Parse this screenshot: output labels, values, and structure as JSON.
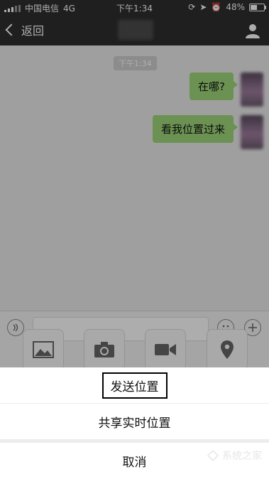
{
  "status_bar": {
    "carrier": "中国电信",
    "network": "4G",
    "time": "下午1:34",
    "battery": "48%",
    "battery_level": 0.48
  },
  "nav": {
    "back_label": "返回"
  },
  "chat": {
    "timestamp": "下午1:34",
    "messages": [
      {
        "text": "在哪?",
        "bubble_color": "#9ed77a"
      },
      {
        "text": "看我位置过来",
        "bubble_color": "#9ed77a"
      }
    ]
  },
  "action_sheet": {
    "send_location": "发送位置",
    "share_live_location": "共享实时位置",
    "cancel": "取消"
  },
  "watermark": "系统之家"
}
